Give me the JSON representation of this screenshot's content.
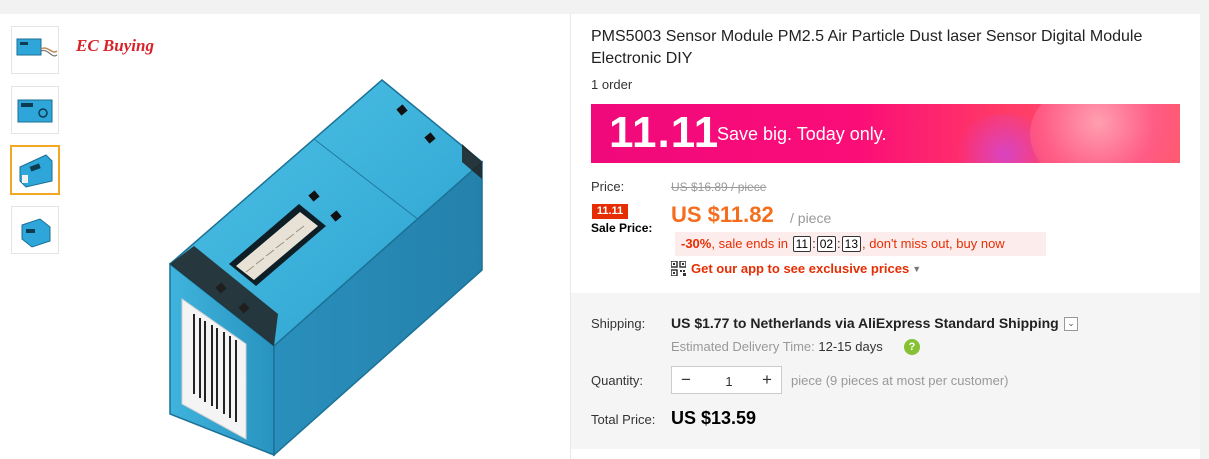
{
  "gallery": {
    "brand_overlay": "EC Buying",
    "thumbnails": [
      {
        "label": "sensor with cable"
      },
      {
        "label": "sensor front view"
      },
      {
        "label": "sensor angled view",
        "selected": true
      },
      {
        "label": "sensor side view"
      }
    ]
  },
  "product": {
    "title": "PMS5003 Sensor Module PM2.5 Air Particle Dust laser Sensor Digital Module Electronic DIY",
    "orders": "1 order"
  },
  "promo": {
    "big": "11.11",
    "sub": "Save big. Today only."
  },
  "price": {
    "price_label": "Price:",
    "original": "US $16.89 / piece",
    "badge": "11.11",
    "sale_label": "Sale Price:",
    "sale": "US $11.82",
    "unit": "/ piece",
    "discount": "-30%",
    "ends_text": ", sale ends in",
    "hours": "11",
    "minutes": "02",
    "seconds": "13",
    "tail_text": ", don't miss out, buy now",
    "app_link": "Get our app to see exclusive prices"
  },
  "shipping": {
    "label": "Shipping:",
    "text": "US $1.77 to Netherlands via AliExpress Standard Shipping",
    "delivery_label": "Estimated Delivery Time:",
    "delivery_days": "12-15 days"
  },
  "quantity": {
    "label": "Quantity:",
    "value": "1",
    "minus": "−",
    "plus": "+",
    "note": "piece (9 pieces at most per customer)"
  },
  "total": {
    "label": "Total Price:",
    "value": "US $13.59"
  },
  "colors": {
    "accent_orange": "#f56e1e",
    "sale_red": "#e62e04",
    "promo_pink": "#f0097b",
    "thumb_selected": "#f5a623"
  }
}
